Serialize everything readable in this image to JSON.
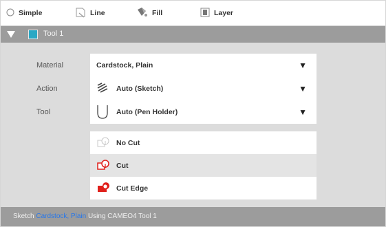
{
  "tabs": [
    {
      "label": "Simple",
      "icon": "radio-icon",
      "active": false
    },
    {
      "label": "Line",
      "icon": "line-icon",
      "active": false
    },
    {
      "label": "Fill",
      "icon": "fill-icon",
      "active": false
    },
    {
      "label": "Layer",
      "icon": "layer-icon",
      "active": false
    }
  ],
  "tool": {
    "name": "Tool 1",
    "color": "#2aa8c4"
  },
  "settings": {
    "material_label": "Material",
    "material_value": "Cardstock, Plain",
    "action_label": "Action",
    "action_value": "Auto (Sketch)",
    "tool_label": "Tool",
    "tool_value": "Auto (Pen Holder)",
    "arrow": "▼"
  },
  "cut_options": [
    {
      "label": "No Cut",
      "selected": false
    },
    {
      "label": "Cut",
      "selected": true
    },
    {
      "label": "Cut Edge",
      "selected": false
    }
  ],
  "status": {
    "prefix": "Sketch",
    "material": "Cardstock, Plain",
    "suffix": "Using CAMEO4 Tool 1"
  },
  "colors": {
    "accent_red": "#e0201b",
    "link_blue": "#2a78e8",
    "header_gray": "#9c9c9c"
  }
}
